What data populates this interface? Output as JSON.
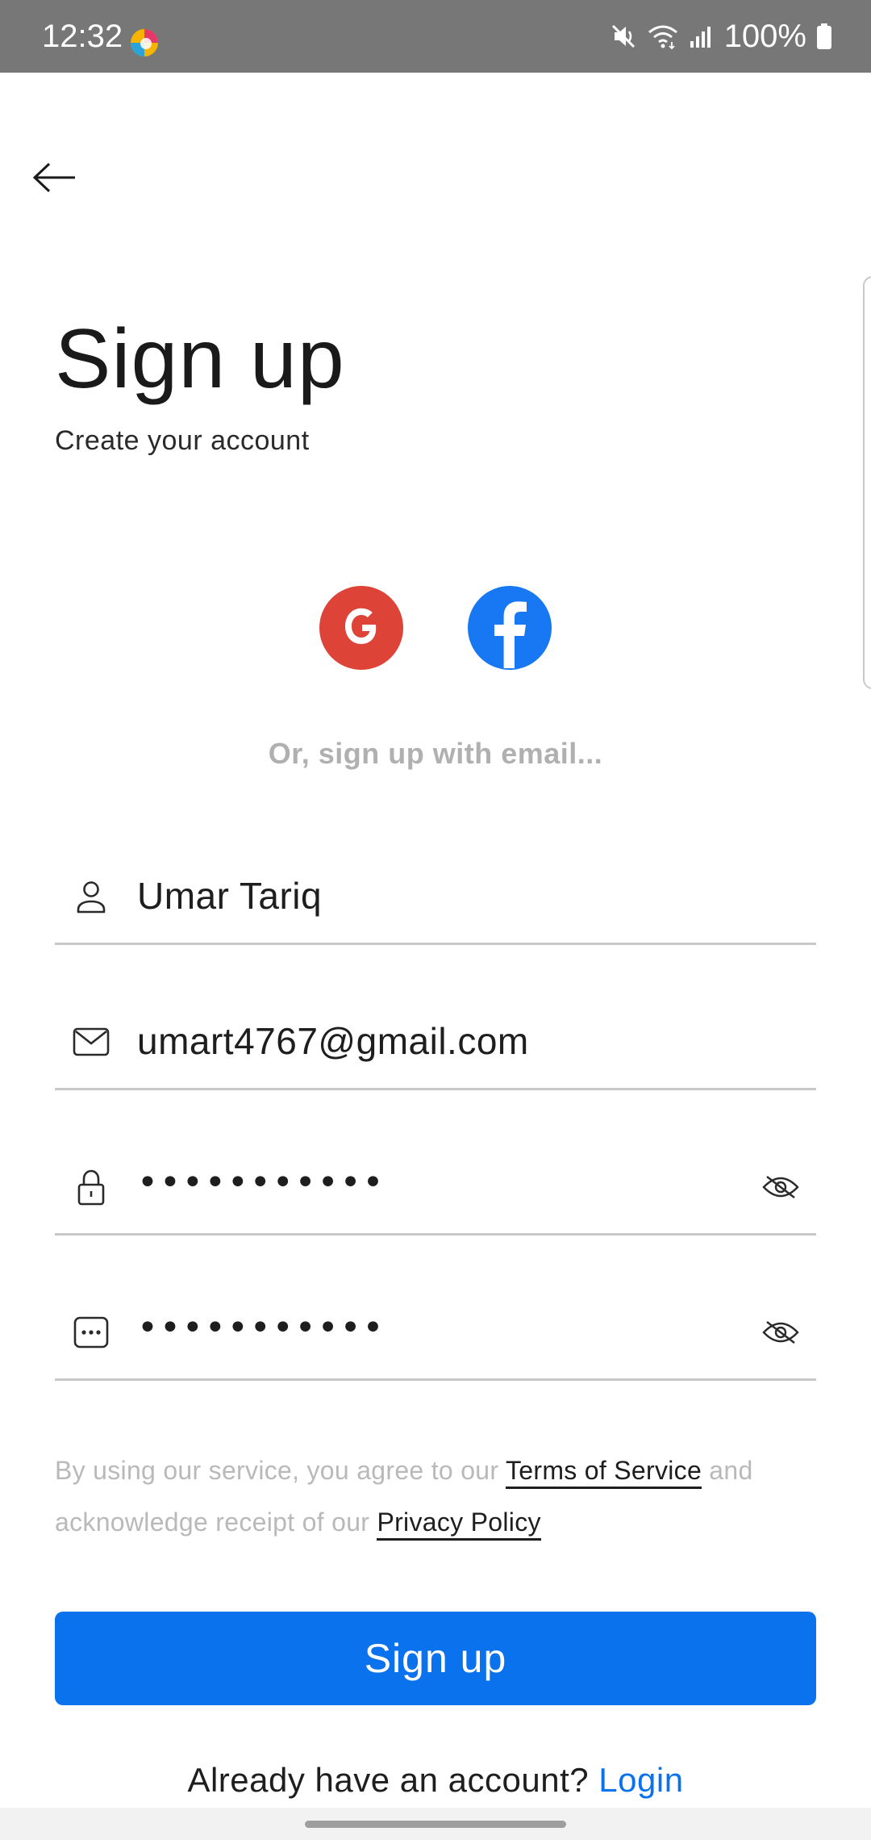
{
  "status_bar": {
    "time": "12:32",
    "battery_percent": "100%",
    "icons": [
      "colorful-app-icon",
      "mute-icon",
      "wifi-icon",
      "signal-icon",
      "battery-icon"
    ]
  },
  "header": {
    "back_icon": "arrow-left-icon"
  },
  "title": "Sign up",
  "subtitle": "Create your account",
  "social": {
    "google": {
      "icon": "google-icon",
      "color": "#dd4337"
    },
    "facebook": {
      "icon": "facebook-icon",
      "color": "#1877f2"
    }
  },
  "divider_text": "Or, sign up with email...",
  "form": {
    "name": {
      "icon": "user-icon",
      "value": "Umar Tariq"
    },
    "email": {
      "icon": "mail-icon",
      "value": "umart4767@gmail.com"
    },
    "password": {
      "icon": "lock-icon",
      "value": "•••••••••••",
      "toggle_icon": "eye-hidden-icon"
    },
    "confirm_password": {
      "icon": "password-dots-icon",
      "value": "•••••••••••",
      "toggle_icon": "eye-hidden-icon"
    }
  },
  "legal": {
    "text_1": "By using our service, you agree to our ",
    "terms_link": "Terms of Service",
    "text_2": " and acknowledge receipt of our ",
    "privacy_link": "Privacy Policy"
  },
  "signup_button": "Sign up",
  "login_prompt": {
    "text": "Already have an account? ",
    "link": "Login"
  },
  "colors": {
    "primary": "#0b72ee",
    "status_bar": "#777777",
    "muted_text": "#b0b0b0",
    "field_line": "#c8c8c8"
  }
}
